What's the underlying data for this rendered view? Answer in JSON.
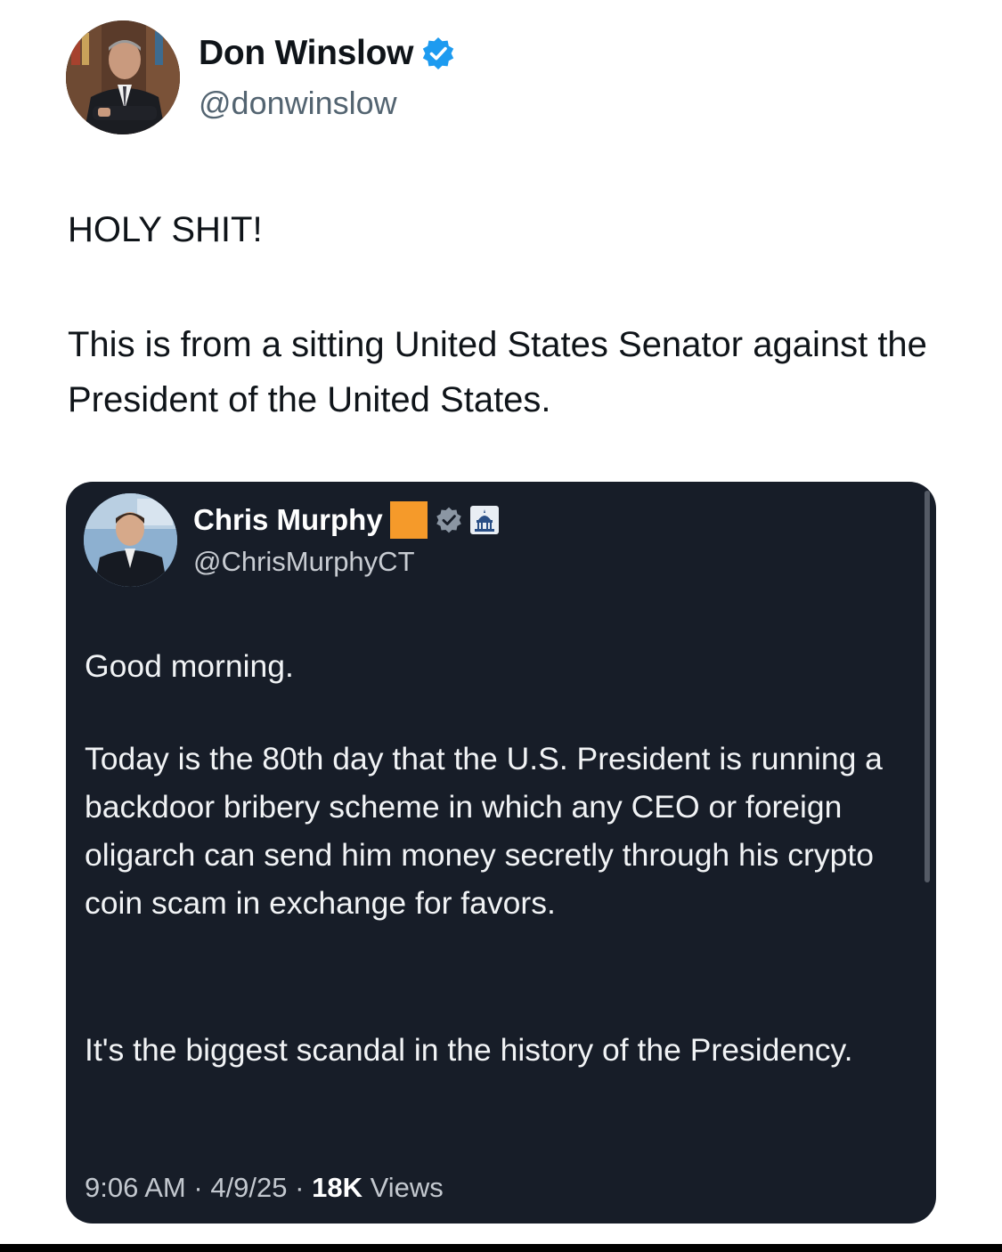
{
  "outer_tweet": {
    "author_name": "Don Winslow",
    "author_handle": "@donwinslow",
    "verified": true,
    "headline": "HOLY SHIT!",
    "body": "This is from a sitting United States Senator against the President of the United States."
  },
  "quoted_tweet": {
    "author_name": "Chris Murphy",
    "author_handle": "@ChrisMurphyCT",
    "paragraphs": [
      "Good morning.",
      "Today is the 80th day that the U.S. President is running a backdoor bribery scheme in which any CEO or foreign oligarch can send him money secretly through his crypto coin scam in exchange for favors.",
      "It's the biggest scandal in the history of the Presidency."
    ],
    "time": "9:06 AM",
    "date": "4/9/25",
    "separator": "·",
    "views_count": "18K",
    "views_label": "Views"
  },
  "colors": {
    "verified_blue": "#1d9bf0",
    "card_background": "#171d28",
    "flag_orange": "#f59a2a"
  },
  "icons": {
    "verified": "verified-checkmark-badge",
    "gray_badge": "gray-verified-badge",
    "capitol": "capitol-building-icon"
  }
}
